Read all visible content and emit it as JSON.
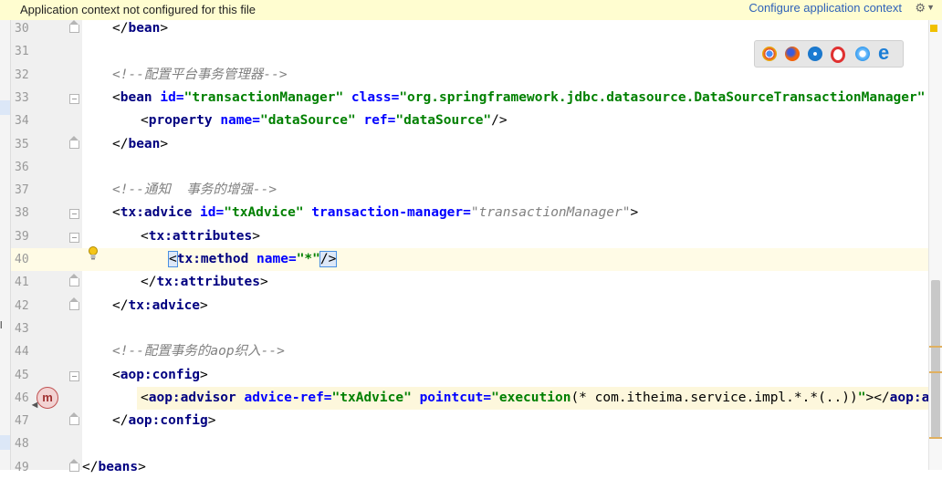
{
  "banner": {
    "message": "Application context not configured for this file",
    "link": "Configure application context"
  },
  "colors": {
    "tag": "#000080",
    "attr": "#0000ff",
    "value": "#008000",
    "comment": "#808080",
    "banner_bg": "#fffdd0"
  },
  "browser_icons": [
    "chrome-icon",
    "firefox-icon",
    "safari-icon",
    "opera-icon",
    "ie-icon",
    "edge-icon"
  ],
  "lines": [
    {
      "n": "30",
      "fold": "close",
      "tokens": [
        [
          "brk",
          "</"
        ],
        [
          "tag",
          "bean"
        ],
        [
          "brk",
          ">"
        ]
      ],
      "indent": 0
    },
    {
      "n": "31",
      "fold": "",
      "tokens": [],
      "indent": 0
    },
    {
      "n": "32",
      "fold": "",
      "tokens": [
        [
          "cmt",
          "<!--配置平台事务管理器-->"
        ]
      ],
      "indent": 0
    },
    {
      "n": "33",
      "fold": "open",
      "tokens": [
        [
          "brk",
          "<"
        ],
        [
          "tag",
          "bean "
        ],
        [
          "attr",
          "id="
        ],
        [
          "val",
          "\"transactionManager\" "
        ],
        [
          "attr",
          "class="
        ],
        [
          "val",
          "\"org.springframework.jdbc.datasource.DataSourceTransactionManager\""
        ]
      ],
      "indent": 0
    },
    {
      "n": "34",
      "fold": "",
      "tokens": [
        [
          "brk",
          "<"
        ],
        [
          "tag",
          "property "
        ],
        [
          "attr",
          "name="
        ],
        [
          "val",
          "\"dataSource\" "
        ],
        [
          "attr",
          "ref="
        ],
        [
          "val",
          "\"dataSource\""
        ],
        [
          "brk",
          "/>"
        ]
      ],
      "indent": 1
    },
    {
      "n": "35",
      "fold": "close",
      "tokens": [
        [
          "brk",
          "</"
        ],
        [
          "tag",
          "bean"
        ],
        [
          "brk",
          ">"
        ]
      ],
      "indent": 0
    },
    {
      "n": "36",
      "fold": "",
      "tokens": [],
      "indent": 0
    },
    {
      "n": "37",
      "fold": "",
      "tokens": [
        [
          "cmt",
          "<!--通知  事务的增强-->"
        ]
      ],
      "indent": 0
    },
    {
      "n": "38",
      "fold": "open",
      "tokens": [
        [
          "brk",
          "<"
        ],
        [
          "tag",
          "tx:advice "
        ],
        [
          "attr",
          "id="
        ],
        [
          "val",
          "\"txAdvice\" "
        ],
        [
          "attr",
          "transaction-manager="
        ],
        [
          "cmt",
          "\"transactionManager\""
        ],
        [
          "brk",
          ">"
        ]
      ],
      "indent": 0
    },
    {
      "n": "39",
      "fold": "open",
      "tokens": [
        [
          "brk",
          "<"
        ],
        [
          "tag",
          "tx:attributes"
        ],
        [
          "brk",
          ">"
        ]
      ],
      "indent": 1
    },
    {
      "n": "40",
      "fold": "",
      "tokens": [
        [
          "brk",
          "<"
        ],
        [
          "tag",
          "tx:method "
        ],
        [
          "attr",
          "name="
        ],
        [
          "val",
          "\"*\""
        ],
        [
          "brk",
          "/>"
        ]
      ],
      "indent": 2
    },
    {
      "n": "41",
      "fold": "close",
      "tokens": [
        [
          "brk",
          "</"
        ],
        [
          "tag",
          "tx:attributes"
        ],
        [
          "brk",
          ">"
        ]
      ],
      "indent": 1
    },
    {
      "n": "42",
      "fold": "close",
      "tokens": [
        [
          "brk",
          "</"
        ],
        [
          "tag",
          "tx:advice"
        ],
        [
          "brk",
          ">"
        ]
      ],
      "indent": 0
    },
    {
      "n": "43",
      "fold": "",
      "tokens": [],
      "indent": 0
    },
    {
      "n": "44",
      "fold": "",
      "tokens": [
        [
          "cmt",
          "<!--配置事务的aop织入-->"
        ]
      ],
      "indent": 0
    },
    {
      "n": "45",
      "fold": "open",
      "tokens": [
        [
          "brk",
          "<"
        ],
        [
          "tag",
          "aop:config"
        ],
        [
          "brk",
          ">"
        ]
      ],
      "indent": 0
    },
    {
      "n": "46",
      "fold": "",
      "tokens": [
        [
          "brk",
          "<"
        ],
        [
          "tag",
          "aop:advisor "
        ],
        [
          "attr",
          "advice-ref="
        ],
        [
          "val",
          "\"txAdvice\" "
        ],
        [
          "attr",
          "pointcut="
        ],
        [
          "val",
          "\"execution"
        ],
        [
          "brk",
          "(* com.itheima.service.impl.*.*(..))"
        ],
        [
          "val",
          "\""
        ],
        [
          "brk",
          "></"
        ],
        [
          "tag",
          "aop:advisor"
        ],
        [
          "brk",
          ">"
        ]
      ],
      "indent": 1
    },
    {
      "n": "47",
      "fold": "close",
      "tokens": [
        [
          "brk",
          "</"
        ],
        [
          "tag",
          "aop:config"
        ],
        [
          "brk",
          ">"
        ]
      ],
      "indent": 0
    },
    {
      "n": "48",
      "fold": "",
      "tokens": [],
      "indent": 0
    },
    {
      "n": "49",
      "fold": "close",
      "tokens": [
        [
          "brk",
          "</"
        ],
        [
          "tag",
          "beans"
        ],
        [
          "brk",
          ">"
        ]
      ],
      "indent": -1
    }
  ]
}
